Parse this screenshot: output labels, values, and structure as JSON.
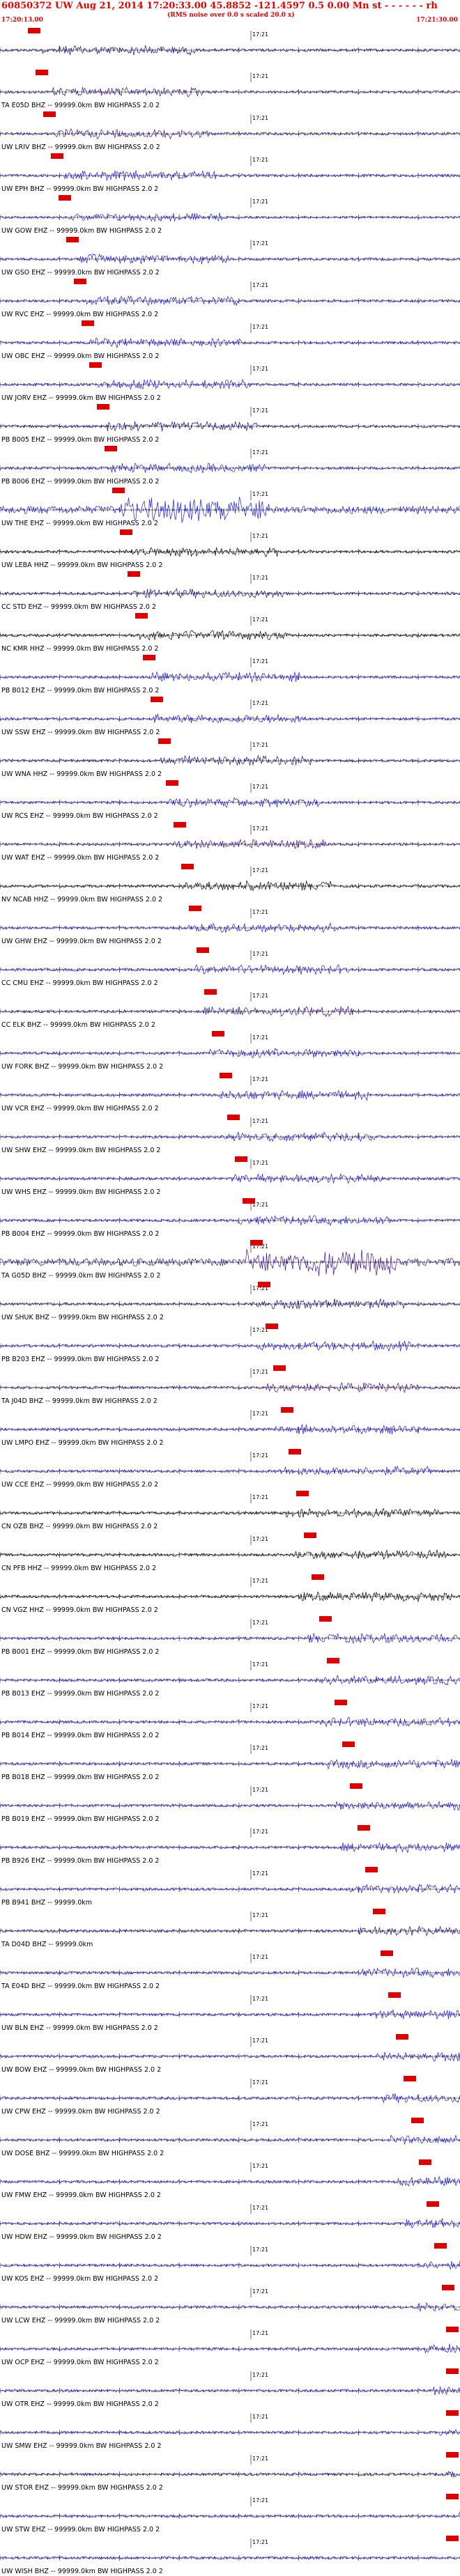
{
  "header": {
    "title": "60850372 UW Aug 21, 2014 17:20:33.00   45.8852 -121.4597  0.5 0.00 Mn st - - - - - - rh",
    "subtitle": "(RMS noise over 0.0 s scaled 20.0 x)",
    "time_left": "17:20:13.00",
    "time_right": "17:21:30.00"
  },
  "minute_mark_label": "17:21",
  "colors": {
    "header_red": "#e00000",
    "pick_red": "#dd0000",
    "blue": "#1a1ae6",
    "navy": "#1a0a80",
    "purple": "#3a1090",
    "black": "#000000"
  },
  "channels": [
    {
      "label": "",
      "color": "navy"
    },
    {
      "label": "TA E05D BHZ -- 99999.0km BW  HIGHPASS  2.0  2",
      "color": "purple"
    },
    {
      "label": "UW LRIV BHZ -- 99999.0km BW  HIGHPASS  2.0  2",
      "color": "purple"
    },
    {
      "label": "UW EPH BHZ -- 99999.0km BW  HIGHPASS  2.0  2",
      "color": "blue"
    },
    {
      "label": "UW GOW EHZ -- 99999.0km BW  HIGHPASS  2.0  2",
      "color": "blue"
    },
    {
      "label": "UW GSO EHZ -- 99999.0km BW  HIGHPASS  2.0  2",
      "color": "blue"
    },
    {
      "label": "UW RVC EHZ -- 99999.0km BW  HIGHPASS  2.0  2",
      "color": "blue"
    },
    {
      "label": "UW OBC EHZ -- 99999.0km BW  HIGHPASS  2.0  2",
      "color": "blue"
    },
    {
      "label": "UW JORV EHZ -- 99999.0km BW  HIGHPASS  2.0  2",
      "color": "blue"
    },
    {
      "label": "PB B005 EHZ -- 99999.0km BW  HIGHPASS  2.0  2",
      "color": "navy"
    },
    {
      "label": "PB B006 EHZ -- 99999.0km BW  HIGHPASS  2.0  2",
      "color": "blue"
    },
    {
      "label": "UW THE EHZ -- 99999.0km BW  HIGHPASS  2.0  2",
      "color": "blue"
    },
    {
      "label": "UW LEBA HHZ -- 99999.0km BW  HIGHPASS  2.0  2",
      "color": "black"
    },
    {
      "label": "CC STD EHZ -- 99999.0km BW  HIGHPASS  2.0  2",
      "color": "navy"
    },
    {
      "label": "NC KMR HHZ -- 99999.0km BW  HIGHPASS  2.0  2",
      "color": "black"
    },
    {
      "label": "PB B012 EHZ -- 99999.0km BW  HIGHPASS  2.0  2",
      "color": "blue"
    },
    {
      "label": "UW SSW EHZ -- 99999.0km BW  HIGHPASS  2.0  2",
      "color": "blue"
    },
    {
      "label": "UW WNA HHZ -- 99999.0km BW  HIGHPASS  2.0  2",
      "color": "navy"
    },
    {
      "label": "UW RCS EHZ -- 99999.0km BW  HIGHPASS  2.0  2",
      "color": "blue"
    },
    {
      "label": "UW WAT EHZ -- 99999.0km BW  HIGHPASS  2.0  2",
      "color": "purple"
    },
    {
      "label": "NV NCAB HHZ -- 99999.0km BW  HIGHPASS  2.0  2",
      "color": "black"
    },
    {
      "label": "UW GHW EHZ -- 99999.0km BW  HIGHPASS  2.0  2",
      "color": "blue"
    },
    {
      "label": "CC CMU EHZ -- 99999.0km BW  HIGHPASS  2.0  2",
      "color": "blue"
    },
    {
      "label": "CC ELK BHZ -- 99999.0km BW  HIGHPASS  2.0  2",
      "color": "purple"
    },
    {
      "label": "UW FORK BHZ -- 99999.0km BW  HIGHPASS  2.0  2",
      "color": "blue"
    },
    {
      "label": "UW VCR EHZ -- 99999.0km BW  HIGHPASS  2.0  2",
      "color": "blue"
    },
    {
      "label": "UW SHW EHZ -- 99999.0km BW  HIGHPASS  2.0  2",
      "color": "blue"
    },
    {
      "label": "UW WHS EHZ -- 99999.0km BW  HIGHPASS  2.0  2",
      "color": "blue"
    },
    {
      "label": "PB B004 EHZ -- 99999.0km BW  HIGHPASS  2.0  2",
      "color": "blue"
    },
    {
      "label": "TA G05D BHZ -- 99999.0km BW  HIGHPASS  2.0  2",
      "color": "purple"
    },
    {
      "label": "UW SHUK BHZ -- 99999.0km BW  HIGHPASS  2.0  2",
      "color": "navy"
    },
    {
      "label": "PB B203 EHZ -- 99999.0km BW  HIGHPASS  2.0  2",
      "color": "blue"
    },
    {
      "label": "TA J04D BHZ -- 99999.0km BW  HIGHPASS  2.0  2",
      "color": "purple"
    },
    {
      "label": "UW LMPO EHZ -- 99999.0km BW  HIGHPASS  2.0  2",
      "color": "blue"
    },
    {
      "label": "UW CCE EHZ -- 99999.0km BW  HIGHPASS  2.0  2",
      "color": "blue"
    },
    {
      "label": "CN OZB BHZ -- 99999.0km BW  HIGHPASS  2.0  2",
      "color": "black"
    },
    {
      "label": "CN PFB HHZ -- 99999.0km BW  HIGHPASS  2.0  2",
      "color": "black"
    },
    {
      "label": "CN VGZ HHZ -- 99999.0km BW  HIGHPASS  2.0  2",
      "color": "black"
    },
    {
      "label": "PB B001 EHZ -- 99999.0km BW  HIGHPASS  2.0  2",
      "color": "blue"
    },
    {
      "label": "PB B013 EHZ -- 99999.0km BW  HIGHPASS  2.0  2",
      "color": "blue"
    },
    {
      "label": "PB B014 EHZ -- 99999.0km BW  HIGHPASS  2.0  2",
      "color": "blue"
    },
    {
      "label": "PB B018 EHZ -- 99999.0km BW  HIGHPASS  2.0  2",
      "color": "blue"
    },
    {
      "label": "PB B019 EHZ -- 99999.0km BW  HIGHPASS  2.0  2",
      "color": "blue"
    },
    {
      "label": "PB B926 EHZ -- 99999.0km BW  HIGHPASS  2.0  2",
      "color": "blue"
    },
    {
      "label": "PB B941 BHZ -- 99999.0km",
      "color": "blue"
    },
    {
      "label": "TA D04D BHZ -- 99999.0km",
      "color": "navy"
    },
    {
      "label": "TA E04D BHZ -- 99999.0km BW  HIGHPASS  2.0  2",
      "color": "blue"
    },
    {
      "label": "UW BLN EHZ -- 99999.0km BW  HIGHPASS  2.0  2",
      "color": "blue"
    },
    {
      "label": "UW BOW EHZ -- 99999.0km BW  HIGHPASS  2.0  2",
      "color": "blue"
    },
    {
      "label": "UW CPW EHZ -- 99999.0km BW  HIGHPASS  2.0  2",
      "color": "blue"
    },
    {
      "label": "UW DOSE BHZ -- 99999.0km BW  HIGHPASS  2.0  2",
      "color": "blue"
    },
    {
      "label": "UW FMW EHZ -- 99999.0km BW  HIGHPASS  2.0  2",
      "color": "blue"
    },
    {
      "label": "UW HDW EHZ -- 99999.0km BW  HIGHPASS  2.0  2",
      "color": "blue"
    },
    {
      "label": "UW KOS EHZ -- 99999.0km BW  HIGHPASS  2.0  2",
      "color": "blue"
    },
    {
      "label": "UW LCW EHZ -- 99999.0km BW  HIGHPASS  2.0  2",
      "color": "blue"
    },
    {
      "label": "UW OCP EHZ -- 99999.0km BW  HIGHPASS  2.0  2",
      "color": "blue"
    },
    {
      "label": "UW OTR EHZ -- 99999.0km BW  HIGHPASS  2.0  2",
      "color": "blue"
    },
    {
      "label": "UW SMW EHZ -- 99999.0km BW  HIGHPASS  2.0  2",
      "color": "blue"
    },
    {
      "label": "UW STOR EHZ -- 99999.0km BW  HIGHPASS  2.0  2",
      "color": "navy"
    },
    {
      "label": "UW STW EHZ -- 99999.0km BW  HIGHPASS  2.0  2",
      "color": "blue"
    },
    {
      "label": "UW WISH BHZ -- 99999.0km BW  HIGHPASS  2.0  2",
      "color": "blue"
    }
  ]
}
